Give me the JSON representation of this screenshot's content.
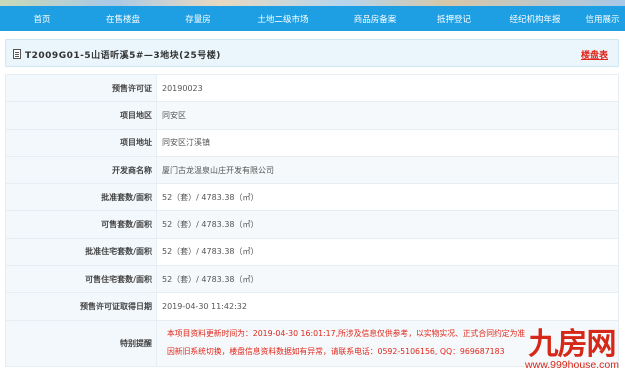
{
  "nav": {
    "items": [
      {
        "label": "首页"
      },
      {
        "label": "在售楼盘"
      },
      {
        "label": "存量房"
      },
      {
        "label": "土地二级市场"
      },
      {
        "label": "商品房备案"
      },
      {
        "label": "抵押登记"
      },
      {
        "label": "经纪机构年报"
      },
      {
        "label": "信用展示"
      }
    ]
  },
  "header": {
    "title": "T2009G01-5山语听溪5#—3地块(25号楼)",
    "plan_link": "楼盘表"
  },
  "details": {
    "rows": [
      {
        "label": "预售许可证",
        "value": "20190023"
      },
      {
        "label": "项目地区",
        "value": "同安区"
      },
      {
        "label": "项目地址",
        "value": "同安区汀溪镇"
      },
      {
        "label": "开发商名称",
        "value": "厦门古龙温泉山庄开发有限公司"
      },
      {
        "label": "批准套数/面积",
        "value": "52（套）/ 4783.38（㎡）"
      },
      {
        "label": "可售套数/面积",
        "value": "52（套）/ 4783.38（㎡）"
      },
      {
        "label": "批准住宅套数/面积",
        "value": "52（套）/ 4783.38（㎡）"
      },
      {
        "label": "可售住宅套数/面积",
        "value": "52（套）/ 4783.38（㎡）"
      },
      {
        "label": "预售许可证取得日期",
        "value": "2019-04-30 11:42:32"
      }
    ],
    "notice": {
      "label": "特别提醒",
      "line1": "本项目资料更新时间为：2019-04-30 16:01:17,所涉及信息仅供参考，以实物实况、正式合同约定为准",
      "line2": "因新旧系统切换，楼盘信息资料数据如有异常，请联系电话：0592-5106156, QQ：969687183"
    }
  },
  "watermark": {
    "logo": "九房网",
    "url": "www.999house.com"
  },
  "colors": {
    "nav_bg": "#1e9fe3",
    "accent_red": "#e0261a"
  }
}
